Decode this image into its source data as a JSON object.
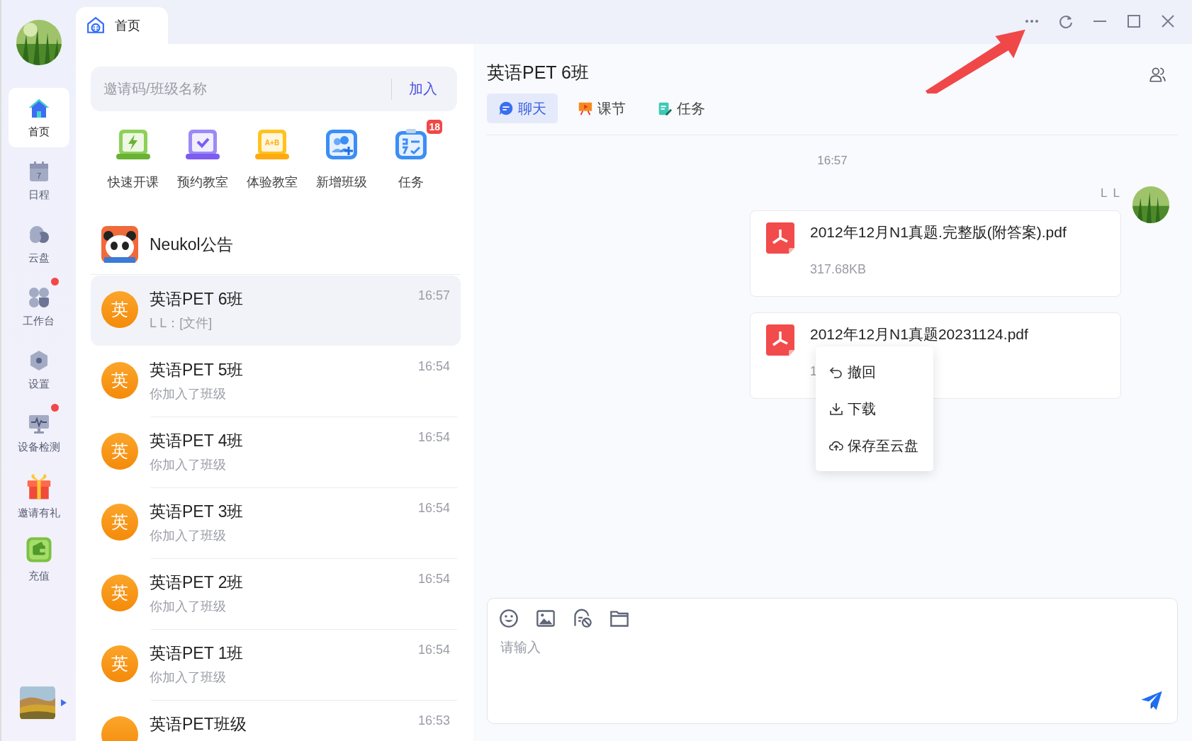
{
  "nav": [
    {
      "label": "首页",
      "selected": true,
      "dot": false
    },
    {
      "label": "日程",
      "selected": false,
      "dot": false
    },
    {
      "label": "云盘",
      "selected": false,
      "dot": false
    },
    {
      "label": "工作台",
      "selected": false,
      "dot": true
    },
    {
      "label": "设置",
      "selected": false,
      "dot": false
    },
    {
      "label": "设备检测",
      "selected": false,
      "dot": true
    },
    {
      "label": "邀请有礼",
      "selected": false,
      "dot": false
    },
    {
      "label": "充值",
      "selected": false,
      "dot": false
    }
  ],
  "schedule_day": "7",
  "tab": {
    "label": "首页"
  },
  "search": {
    "placeholder": "邀请码/班级名称",
    "button": "加入"
  },
  "actions": [
    {
      "label": "快速开课"
    },
    {
      "label": "预约教室"
    },
    {
      "label": "体验教室",
      "icon_text": "A+B"
    },
    {
      "label": "新增班级"
    },
    {
      "label": "任务",
      "badge": "18"
    }
  ],
  "notice": {
    "title": "Neukol公告"
  },
  "conversations": [
    {
      "avatar": "英",
      "title": "英语PET 6班",
      "preview": "L L：[文件]",
      "time": "16:57",
      "selected": true
    },
    {
      "avatar": "英",
      "title": "英语PET 5班",
      "preview": "你加入了班级",
      "time": "16:54",
      "selected": false
    },
    {
      "avatar": "英",
      "title": "英语PET 4班",
      "preview": "你加入了班级",
      "time": "16:54",
      "selected": false
    },
    {
      "avatar": "英",
      "title": "英语PET 3班",
      "preview": "你加入了班级",
      "time": "16:54",
      "selected": false
    },
    {
      "avatar": "英",
      "title": "英语PET 2班",
      "preview": "你加入了班级",
      "time": "16:54",
      "selected": false
    },
    {
      "avatar": "英",
      "title": "英语PET 1班",
      "preview": "你加入了班级",
      "time": "16:54",
      "selected": false
    },
    {
      "title": "英语PET班级",
      "time": "16:53",
      "selected": false
    }
  ],
  "chat": {
    "title": "英语PET 6班",
    "tabs": [
      {
        "label": "聊天",
        "selected": true
      },
      {
        "label": "课节",
        "selected": false
      },
      {
        "label": "任务",
        "selected": false
      }
    ],
    "timestamp": "16:57",
    "sender": "L L",
    "messages": [
      {
        "file": "2012年12月N1真题.完整版(附答案).pdf",
        "size": "317.68KB"
      },
      {
        "file": "2012年12月N1真题20231124.pdf",
        "size": "1"
      }
    ],
    "context_menu": [
      {
        "label": "撤回"
      },
      {
        "label": "下载"
      },
      {
        "label": "保存至云盘"
      }
    ],
    "input": {
      "placeholder": "请输入"
    }
  }
}
